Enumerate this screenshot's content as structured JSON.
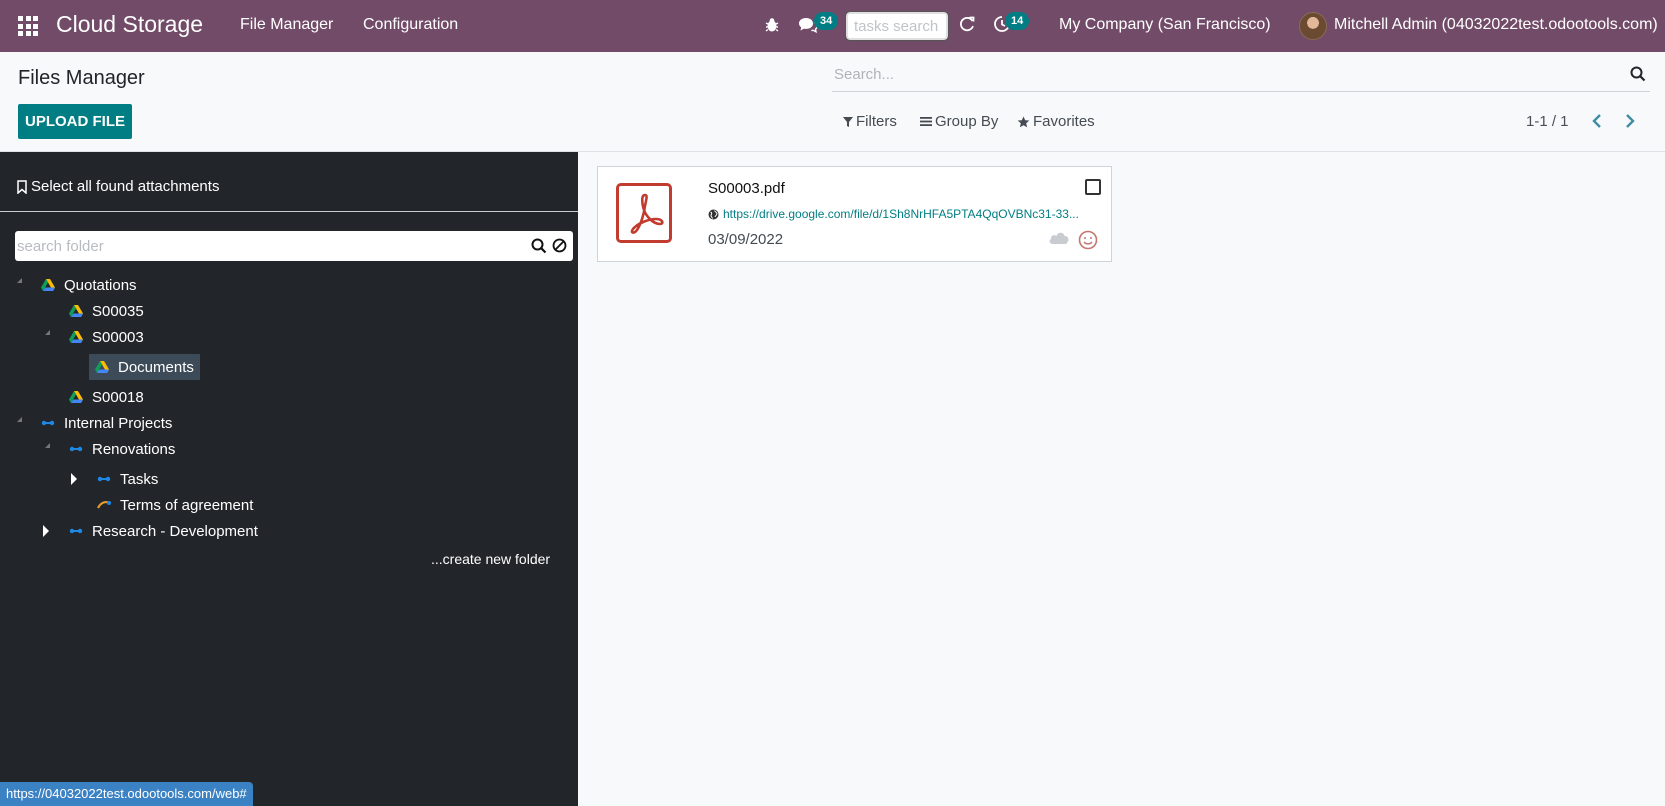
{
  "navbar": {
    "brand": "Cloud Storage",
    "menu": [
      "File Manager",
      "Configuration"
    ],
    "messages_count": "34",
    "activities_count": "14",
    "tasks_search_placeholder": "tasks search",
    "company": "My Company (San Francisco)",
    "user": "Mitchell Admin (04032022test.odootools.com)",
    "colors": {
      "primary": "#714b67",
      "accent": "#017e84"
    }
  },
  "control_panel": {
    "title": "Files Manager",
    "upload_label": "UPLOAD FILE",
    "search_placeholder": "Search...",
    "filters_label": "Filters",
    "group_by_label": "Group By",
    "favorites_label": "Favorites",
    "pager": "1-1 / 1"
  },
  "sidebar": {
    "select_all_label": "Select all found attachments",
    "folder_search_placeholder": "search folder",
    "create_folder_label": "...create new folder",
    "tree": [
      {
        "label": "Quotations",
        "icon": "google-drive-icon",
        "expanded": true
      },
      {
        "label": "S00035",
        "icon": "google-drive-icon"
      },
      {
        "label": "S00003",
        "icon": "google-drive-icon",
        "expanded": true
      },
      {
        "label": "Documents",
        "icon": "google-drive-icon",
        "selected": true
      },
      {
        "label": "S00018",
        "icon": "google-drive-icon"
      },
      {
        "label": "Internal Projects",
        "icon": "sharepoint-icon",
        "expanded": true
      },
      {
        "label": "Renovations",
        "icon": "sharepoint-icon",
        "expanded": true
      },
      {
        "label": "Tasks",
        "icon": "sharepoint-icon",
        "collapsed": true
      },
      {
        "label": "Terms of agreement",
        "icon": "sharepoint-icon"
      },
      {
        "label": "Research - Development",
        "icon": "sharepoint-icon",
        "collapsed": true
      }
    ]
  },
  "files": [
    {
      "name": "S00003.pdf",
      "url": "https://drive.google.com/file/d/1Sh8NrHFA5PTA4QqOVBNc31-33...",
      "date": "03/09/2022",
      "icon": "pdf-icon"
    }
  ],
  "statusbar": {
    "url": "https://04032022test.odootools.com/web#"
  }
}
